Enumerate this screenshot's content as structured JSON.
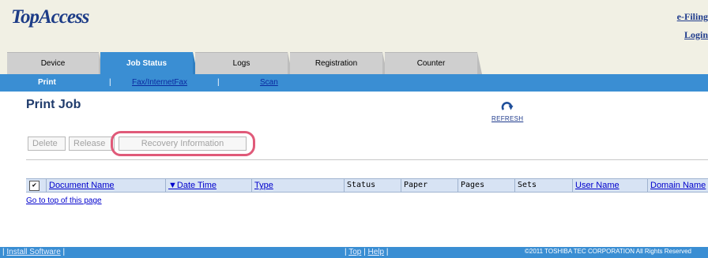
{
  "header": {
    "logo": "TopAccess",
    "efiling_link": "e-Filing",
    "login_link": "Login"
  },
  "tabs": [
    {
      "label": "Device",
      "active": false
    },
    {
      "label": "Job Status",
      "active": true
    },
    {
      "label": "Logs",
      "active": false
    },
    {
      "label": "Registration",
      "active": false
    },
    {
      "label": "Counter",
      "active": false
    }
  ],
  "subnav": {
    "print": "Print",
    "separator": "|",
    "fax": "Fax/InternetFax",
    "scan": "Scan"
  },
  "page": {
    "title": "Print Job",
    "refresh_label": "REFRESH",
    "refresh_icon": "refresh-arrow-icon"
  },
  "buttons": {
    "delete": "Delete",
    "release": "Release",
    "recovery": "Recovery Information"
  },
  "table": {
    "columns": [
      {
        "label": "Document Name",
        "sortable": true
      },
      {
        "label": "▼Date Time",
        "sortable": true
      },
      {
        "label": "Type",
        "sortable": true
      },
      {
        "label": "Status",
        "sortable": false
      },
      {
        "label": "Paper",
        "sortable": false
      },
      {
        "label": "Pages",
        "sortable": false
      },
      {
        "label": "Sets",
        "sortable": false
      },
      {
        "label": "User Name",
        "sortable": true
      },
      {
        "label": "Domain Name",
        "sortable": true
      }
    ],
    "checkbox_mark": "✔"
  },
  "goto_top": "Go to top of this page",
  "footer": {
    "install": "Install Software",
    "sep": "|",
    "top": "Top",
    "help": "Help",
    "copyright": "©2011 TOSHIBA TEC CORPORATION All Rights Reserved"
  },
  "colors": {
    "accent": "#3a8ed3",
    "header_bg": "#f1f0e4",
    "highlight": "#e05a79"
  }
}
